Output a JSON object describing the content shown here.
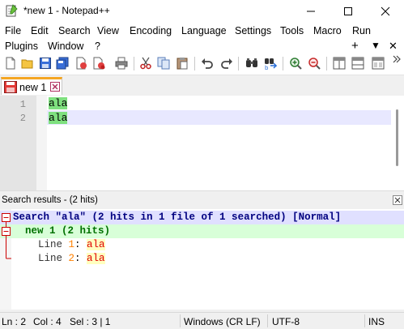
{
  "window": {
    "title": "*new 1 - Notepad++"
  },
  "menubar": {
    "row1": [
      "File",
      "Edit",
      "Search",
      "View",
      "Encoding",
      "Language",
      "Settings",
      "Tools",
      "Macro",
      "Run"
    ],
    "row2": [
      "Plugins",
      "Window",
      "?"
    ],
    "right_glyphs": [
      "+",
      "▼",
      "✕"
    ]
  },
  "tabs": [
    {
      "label": "new 1",
      "modified": true
    }
  ],
  "editor": {
    "lines": [
      {
        "number": "1",
        "text": "ala"
      },
      {
        "number": "2",
        "text": "ala"
      }
    ]
  },
  "search_panel": {
    "title": "Search results - (2 hits)",
    "summary": {
      "prefix": "Search \"",
      "term": "ala",
      "suffix": "\" (2 hits in 1 file of 1 searched) [Normal]"
    },
    "file": "new 1 (2 hits)",
    "hits": [
      {
        "label": "Line ",
        "num": "1",
        "colon": ": ",
        "text": "ala"
      },
      {
        "label": "Line ",
        "num": "2",
        "colon": ": ",
        "text": "ala"
      }
    ]
  },
  "statusbar": {
    "ln": "Ln : 2",
    "col": "Col : 4",
    "sel": "Sel : 3 | 1",
    "eol": "Windows (CR LF)",
    "encoding": "UTF-8",
    "mode": "INS"
  },
  "colors": {
    "match_highlight": "#7fe07f",
    "current_line": "#e8e8ff",
    "search_summary_bg": "#e0e0ff",
    "file_line_bg": "#d8ffd8",
    "fold_marker": "#cc0000",
    "tab_accent": "#f5a623"
  }
}
